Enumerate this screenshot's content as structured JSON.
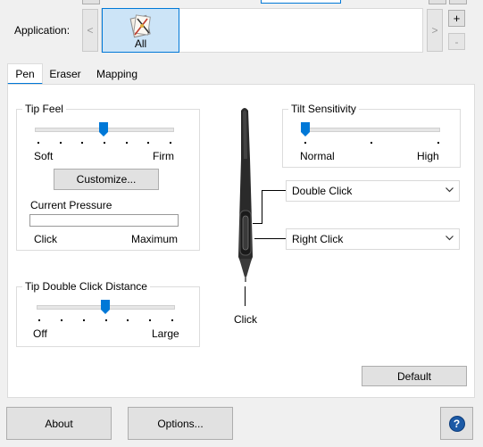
{
  "application": {
    "label": "Application:",
    "selected_app": "All",
    "scroll_left": "<",
    "scroll_right": ">",
    "add": "+",
    "remove": "-"
  },
  "tabs": [
    {
      "label": "Pen",
      "active": true
    },
    {
      "label": "Eraser",
      "active": false
    },
    {
      "label": "Mapping",
      "active": false
    }
  ],
  "tip_feel": {
    "title": "Tip Feel",
    "min_label": "Soft",
    "max_label": "Firm",
    "level": 0.5,
    "customize_label": "Customize...",
    "current_pressure_label": "Current Pressure",
    "pressure_value": 0,
    "pressure_min": "Click",
    "pressure_max": "Maximum"
  },
  "tip_double_click": {
    "title": "Tip Double Click Distance",
    "min_label": "Off",
    "max_label": "Large",
    "level": 0.5
  },
  "tilt": {
    "title": "Tilt Sensitivity",
    "min_label": "Normal",
    "max_label": "High",
    "level": 0.0
  },
  "pen": {
    "upper_button": "Double Click",
    "lower_button": "Right Click",
    "tip_label": "Click"
  },
  "buttons": {
    "default": "Default",
    "about": "About",
    "options": "Options...",
    "help": "?"
  },
  "colors": {
    "accent": "#0078d7",
    "app_tile_bg": "#cce4f7",
    "help_icon": "#1c5aa6"
  }
}
